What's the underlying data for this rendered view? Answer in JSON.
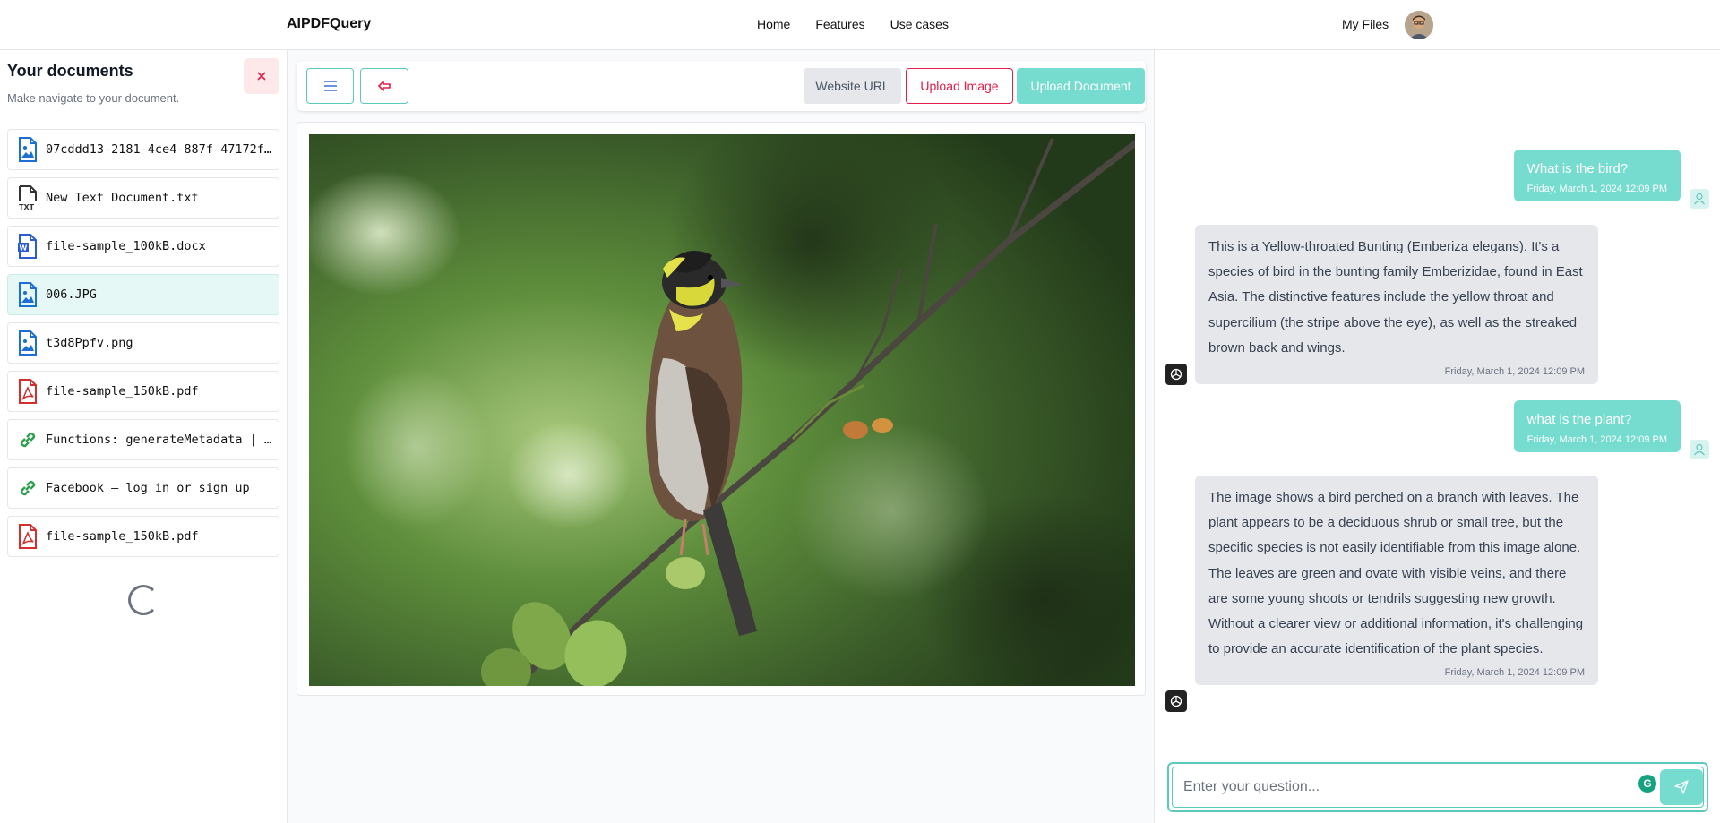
{
  "header": {
    "brand": "AIPDFQuery",
    "nav": [
      {
        "label": "Home"
      },
      {
        "label": "Features"
      },
      {
        "label": "Use cases"
      }
    ],
    "my_files": "My Files"
  },
  "sidebar": {
    "title": "Your documents",
    "subtitle": "Make navigate to your document.",
    "close_icon": "close-icon",
    "items": [
      {
        "name": "07cddd13-2181-4ce4-887f-47172f0…",
        "icon": "image-file-icon",
        "active": false
      },
      {
        "name": "New Text Document.txt",
        "icon": "txt-file-icon",
        "active": false
      },
      {
        "name": "file-sample_100kB.docx",
        "icon": "word-file-icon",
        "active": false
      },
      {
        "name": "006.JPG",
        "icon": "image-file-icon",
        "active": true
      },
      {
        "name": "t3d8Ppfv.png",
        "icon": "image-file-icon",
        "active": false
      },
      {
        "name": "file-sample_150kB.pdf",
        "icon": "pdf-file-icon",
        "active": false
      },
      {
        "name": "Functions: generateMetadata | …",
        "icon": "link-icon",
        "active": false
      },
      {
        "name": "Facebook – log in or sign up",
        "icon": "link-icon",
        "active": false
      },
      {
        "name": "file-sample_150kB.pdf",
        "icon": "pdf-file-icon",
        "active": false
      }
    ]
  },
  "toolbar": {
    "website_url": "Website URL",
    "upload_image": "Upload Image",
    "upload_document": "Upload Document"
  },
  "viewer": {
    "image_subject": "bird on branch photo"
  },
  "chat": {
    "messages": [
      {
        "role": "user",
        "text": "What is the bird?",
        "time": "Friday, March 1, 2024 12:09 PM"
      },
      {
        "role": "assistant",
        "text": "This is a Yellow-throated Bunting (Emberiza elegans). It's a species of bird in the bunting family Emberizidae, found in East Asia. The distinctive features include the yellow throat and supercilium (the stripe above the eye), as well as the streaked brown back and wings.",
        "time": "Friday, March 1, 2024 12:09 PM"
      },
      {
        "role": "user",
        "text": "what is the plant?",
        "time": "Friday, March 1, 2024 12:09 PM"
      },
      {
        "role": "assistant",
        "text": "The image shows a bird perched on a branch with leaves. The plant appears to be a deciduous shrub or small tree, but the specific species is not easily identifiable from this image alone. The leaves are green and ovate with visible veins, and there are some young shoots or tendrils suggesting new growth. Without a clearer view or additional information, it's challenging to provide an accurate identification of the plant species.",
        "time": "Friday, March 1, 2024 12:09 PM"
      }
    ],
    "input_placeholder": "Enter your question...",
    "grammarly_badge": "G"
  },
  "colors": {
    "accent": "#76dccf",
    "accent_border": "#5dc9bc",
    "danger": "#e11d48"
  }
}
